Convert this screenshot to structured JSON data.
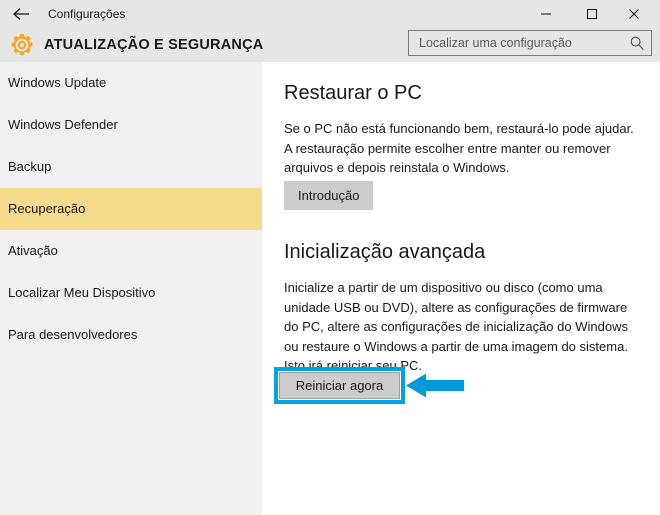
{
  "window": {
    "title": "Configurações",
    "back_icon": "back-arrow-icon",
    "minimize_label": "–",
    "maximize_label": "□",
    "close_label": "×"
  },
  "header": {
    "icon": "gear-icon",
    "title": "ATUALIZAÇÃO E SEGURANÇA"
  },
  "search": {
    "placeholder": "Localizar uma configuração",
    "value": "",
    "icon": "search-icon"
  },
  "sidebar": {
    "items": [
      {
        "label": "Windows Update",
        "selected": false
      },
      {
        "label": "Windows Defender",
        "selected": false
      },
      {
        "label": "Backup",
        "selected": false
      },
      {
        "label": "Recuperação",
        "selected": true
      },
      {
        "label": "Ativação",
        "selected": false
      },
      {
        "label": "Localizar Meu Dispositivo",
        "selected": false
      },
      {
        "label": "Para desenvolvedores",
        "selected": false
      }
    ]
  },
  "content": {
    "sections": [
      {
        "heading": "Restaurar o PC",
        "body": "Se o PC não está funcionando bem, restaurá-lo pode ajudar. A restauração permite escolher entre manter ou remover arquivos e depois reinstala o Windows.",
        "button": "Introdução"
      },
      {
        "heading": "Inicialização avançada",
        "body": "Inicialize a partir de um dispositivo ou disco (como uma unidade USB ou DVD), altere as configurações de firmware do PC, altere as configurações de inicialização do Windows ou restaure o Windows a partir de uma imagem do sistema. Isto irá reiniciar seu PC.",
        "button": "Reiniciar agora"
      }
    ]
  },
  "annotations": {
    "highlight_color": "#00a2e8",
    "arrow_icon": "left-arrow-annotation-icon",
    "arrow_color": "#0099dd",
    "selected_row_color": "#f5da8b",
    "gear_color": "#f5a623"
  }
}
